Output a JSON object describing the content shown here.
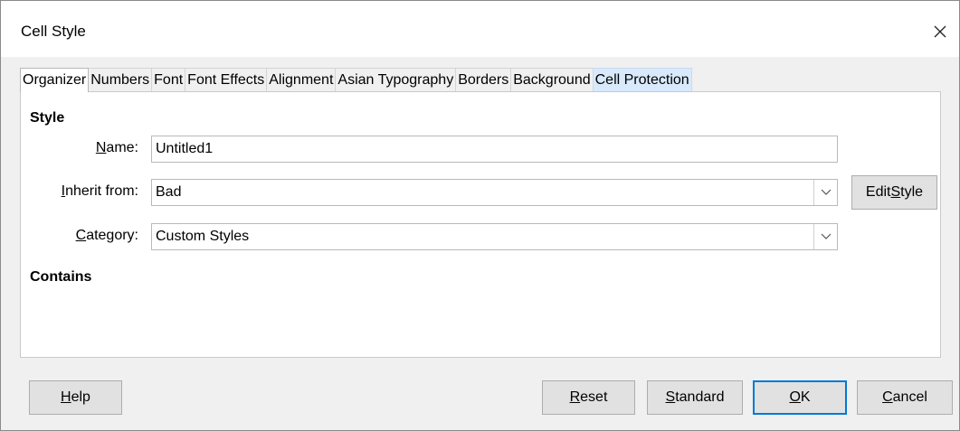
{
  "window": {
    "title": "Cell Style"
  },
  "tabs": [
    {
      "label": "Organizer"
    },
    {
      "label": "Numbers"
    },
    {
      "label": "Font"
    },
    {
      "label": "Font Effects"
    },
    {
      "label": "Alignment"
    },
    {
      "label": "Asian Typography"
    },
    {
      "label": "Borders"
    },
    {
      "label": "Background"
    },
    {
      "label": "Cell Protection"
    }
  ],
  "style_section": {
    "heading": "Style",
    "name": {
      "mn": "N",
      "rest": "ame:",
      "value": "Untitled1"
    },
    "inherit": {
      "mn": "I",
      "rest": "nherit from:",
      "value": "Bad"
    },
    "category": {
      "mn": "C",
      "rest": "ategory:",
      "value": "Custom Styles"
    },
    "edit_style": {
      "pre": "Edit ",
      "mn": "S",
      "rest": "tyle"
    }
  },
  "contains_section": {
    "heading": "Contains"
  },
  "buttons": {
    "help": {
      "mn": "H",
      "rest": "elp"
    },
    "reset": {
      "mn": "R",
      "rest": "eset"
    },
    "standard": {
      "mn": "S",
      "rest": "tandard"
    },
    "ok": {
      "mn": "O",
      "rest": "K"
    },
    "cancel": {
      "mn": "C",
      "rest": "ancel"
    }
  }
}
